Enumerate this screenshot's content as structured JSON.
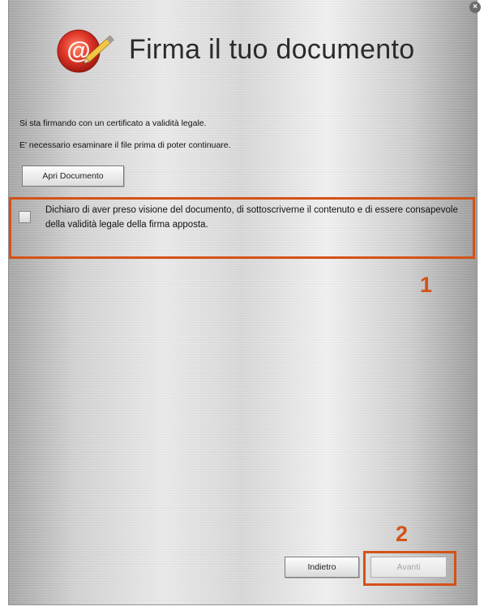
{
  "dialog": {
    "title": "Firma il tuo documento",
    "close_glyph": "×"
  },
  "info": {
    "line1": "Si sta firmando con un certificato a validità legale.",
    "line2": "E' necessario esaminare il file prima di poter continuare."
  },
  "buttons": {
    "open_document": "Apri Documento",
    "back": "Indietro",
    "next": "Avanti"
  },
  "declaration": {
    "checked": false,
    "text": "Dichiaro di aver preso visione del documento, di sottoscriverne il contenuto e di essere consapevole della validità legale della firma apposta."
  },
  "annotations": {
    "step1": "1",
    "step2": "2"
  },
  "colors": {
    "annotation": "#d35218"
  },
  "icons": {
    "logo": "at-sign-pen-logo-icon",
    "close": "close-icon"
  }
}
